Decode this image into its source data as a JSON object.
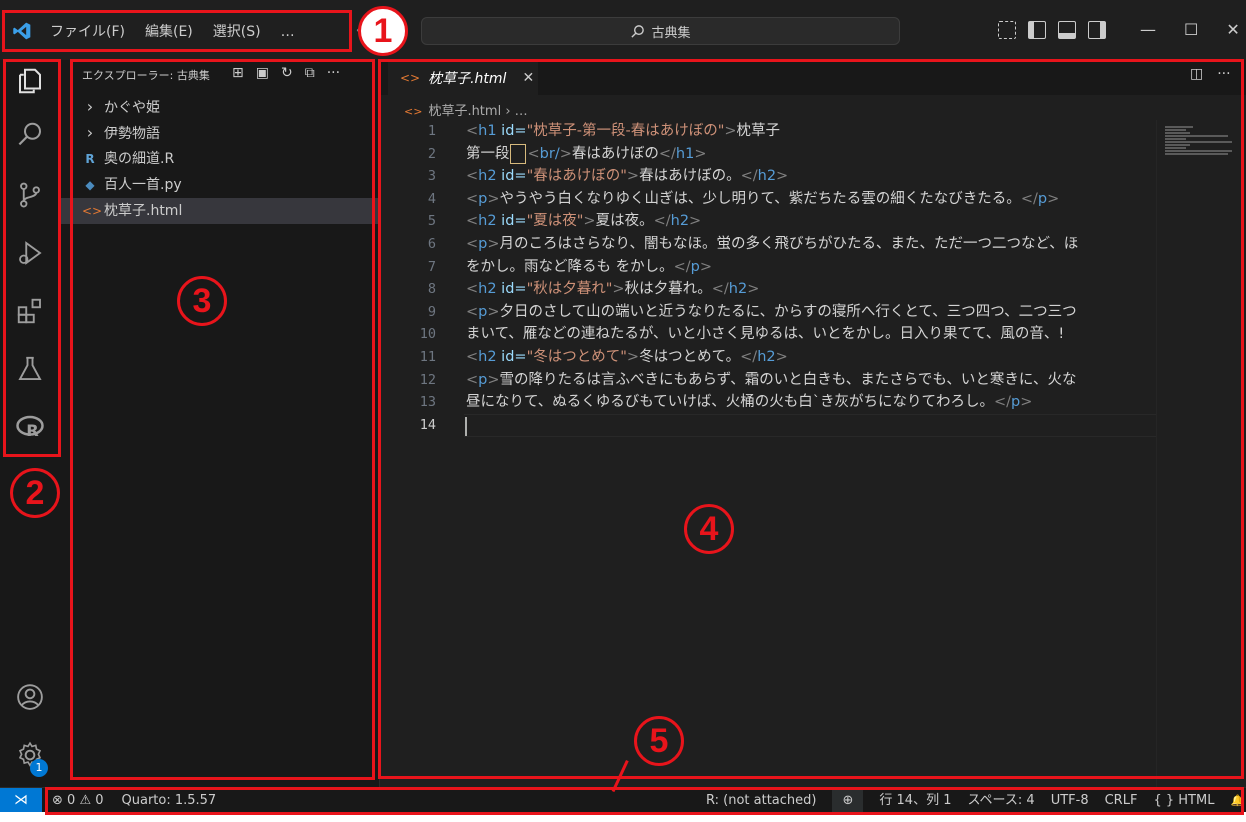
{
  "titlebar": {
    "menu": [
      "ファイル(F)",
      "編集(E)",
      "選択(S)",
      "…"
    ],
    "search_label": "古典集",
    "nav_back": "←",
    "nav_forward": "→",
    "min": "—",
    "max": "☐",
    "close": "✕"
  },
  "sidebar": {
    "title": "エクスプローラー: 古典集",
    "more": "···",
    "items": [
      {
        "label": "かぐや姫",
        "icon": "chevron-right-icon",
        "glyph": "›"
      },
      {
        "label": "伊勢物語",
        "icon": "chevron-right-icon",
        "glyph": "›"
      },
      {
        "label": "奥の細道.R",
        "icon": "r-file-icon",
        "glyph": "R"
      },
      {
        "label": "百人一首.py",
        "icon": "python-file-icon",
        "glyph": "◆"
      },
      {
        "label": "枕草子.html",
        "icon": "html-file-icon",
        "glyph": "<>"
      }
    ]
  },
  "editor": {
    "tab_label": "枕草子.html",
    "tab_glyph": "<>",
    "tab_close": "✕",
    "breadcrumb_file": "枕草子.html",
    "breadcrumb_more": "› …",
    "lines": [
      {
        "n": "1"
      },
      {
        "n": "2"
      },
      {
        "n": "3"
      },
      {
        "n": "4"
      },
      {
        "n": "5"
      },
      {
        "n": "6"
      },
      {
        "n": "7"
      },
      {
        "n": "8"
      },
      {
        "n": "9"
      },
      {
        "n": "10"
      },
      {
        "n": "11"
      },
      {
        "n": "12"
      },
      {
        "n": "13"
      },
      {
        "n": "14"
      }
    ],
    "code": {
      "l1": [
        "<",
        "h1",
        " id=",
        "\"枕草子-第一段-春はあけぼの\"",
        ">",
        "枕草子"
      ],
      "l2": [
        "第一段",
        "<",
        "br/",
        ">",
        "春はあけぼの",
        "</",
        "h1",
        ">"
      ],
      "l3": [
        "<",
        "h2",
        " id=",
        "\"春はあけぼの\"",
        ">",
        "春はあけぼの。",
        "</",
        "h2",
        ">"
      ],
      "l4": [
        "<",
        "p",
        ">",
        "やうやう白くなりゆく山ぎは、少し明りて、紫だちたる雲の細くたなびきたる。",
        "</",
        "p",
        ">"
      ],
      "l5": [
        "<",
        "h2",
        " id=",
        "\"夏は夜\"",
        ">",
        "夏は夜。",
        "</",
        "h2",
        ">"
      ],
      "l6": [
        "<",
        "p",
        ">",
        "月のころはさらなり、闇もなほ。蛍の多く飛びちがひたる、また、ただ一つ二つなど、ほ"
      ],
      "l7": [
        "をかし。雨など降るも をかし。",
        "</",
        "p",
        ">"
      ],
      "l8": [
        "<",
        "h2",
        " id=",
        "\"秋は夕暮れ\"",
        ">",
        "秋は夕暮れ。",
        "</",
        "h2",
        ">"
      ],
      "l9": [
        "<",
        "p",
        ">",
        "夕日のさして山の端いと近うなりたるに、からすの寝所へ行くとて、三つ四つ、二つ三つ"
      ],
      "l10": [
        "まいて、雁などの連ねたるが、いと小さく見ゆるは、いとをかし。日入り果てて、風の音、!"
      ],
      "l11": [
        "<",
        "h2",
        " id=",
        "\"冬はつとめて\"",
        ">",
        "冬はつとめて。",
        "</",
        "h2",
        ">"
      ],
      "l12": [
        "<",
        "p",
        ">",
        "雪の降りたるは言ふべきにもあらず、霜のいと白きも、またさらでも、いと寒きに、火な"
      ],
      "l13": [
        "昼になりて、ぬるくゆるびもていけば、火桶の火も白`き灰がちになりてわろし。",
        "</",
        "p",
        ">"
      ]
    }
  },
  "statusbar": {
    "remote": "⋊",
    "errors": "⊗ 0",
    "warnings": "⚠ 0",
    "quarto": "Quarto: 1.5.57",
    "r_status": "R: (not attached)",
    "zoom": "⊕",
    "position": "行 14、列 1",
    "spaces": "スペース: 4",
    "encoding": "UTF-8",
    "eol": "CRLF",
    "language": "{ } HTML",
    "bell": "🔔"
  },
  "annotations": {
    "n1": "1",
    "n2": "2",
    "n3": "3",
    "n4": "4",
    "n5": "5"
  },
  "badge": "1",
  "colors": {
    "accent": "#0078d4",
    "annotation": "#e8141b",
    "html_tag": "#569cd6",
    "html_attr": "#9cdcfe",
    "html_string": "#ce9178"
  }
}
